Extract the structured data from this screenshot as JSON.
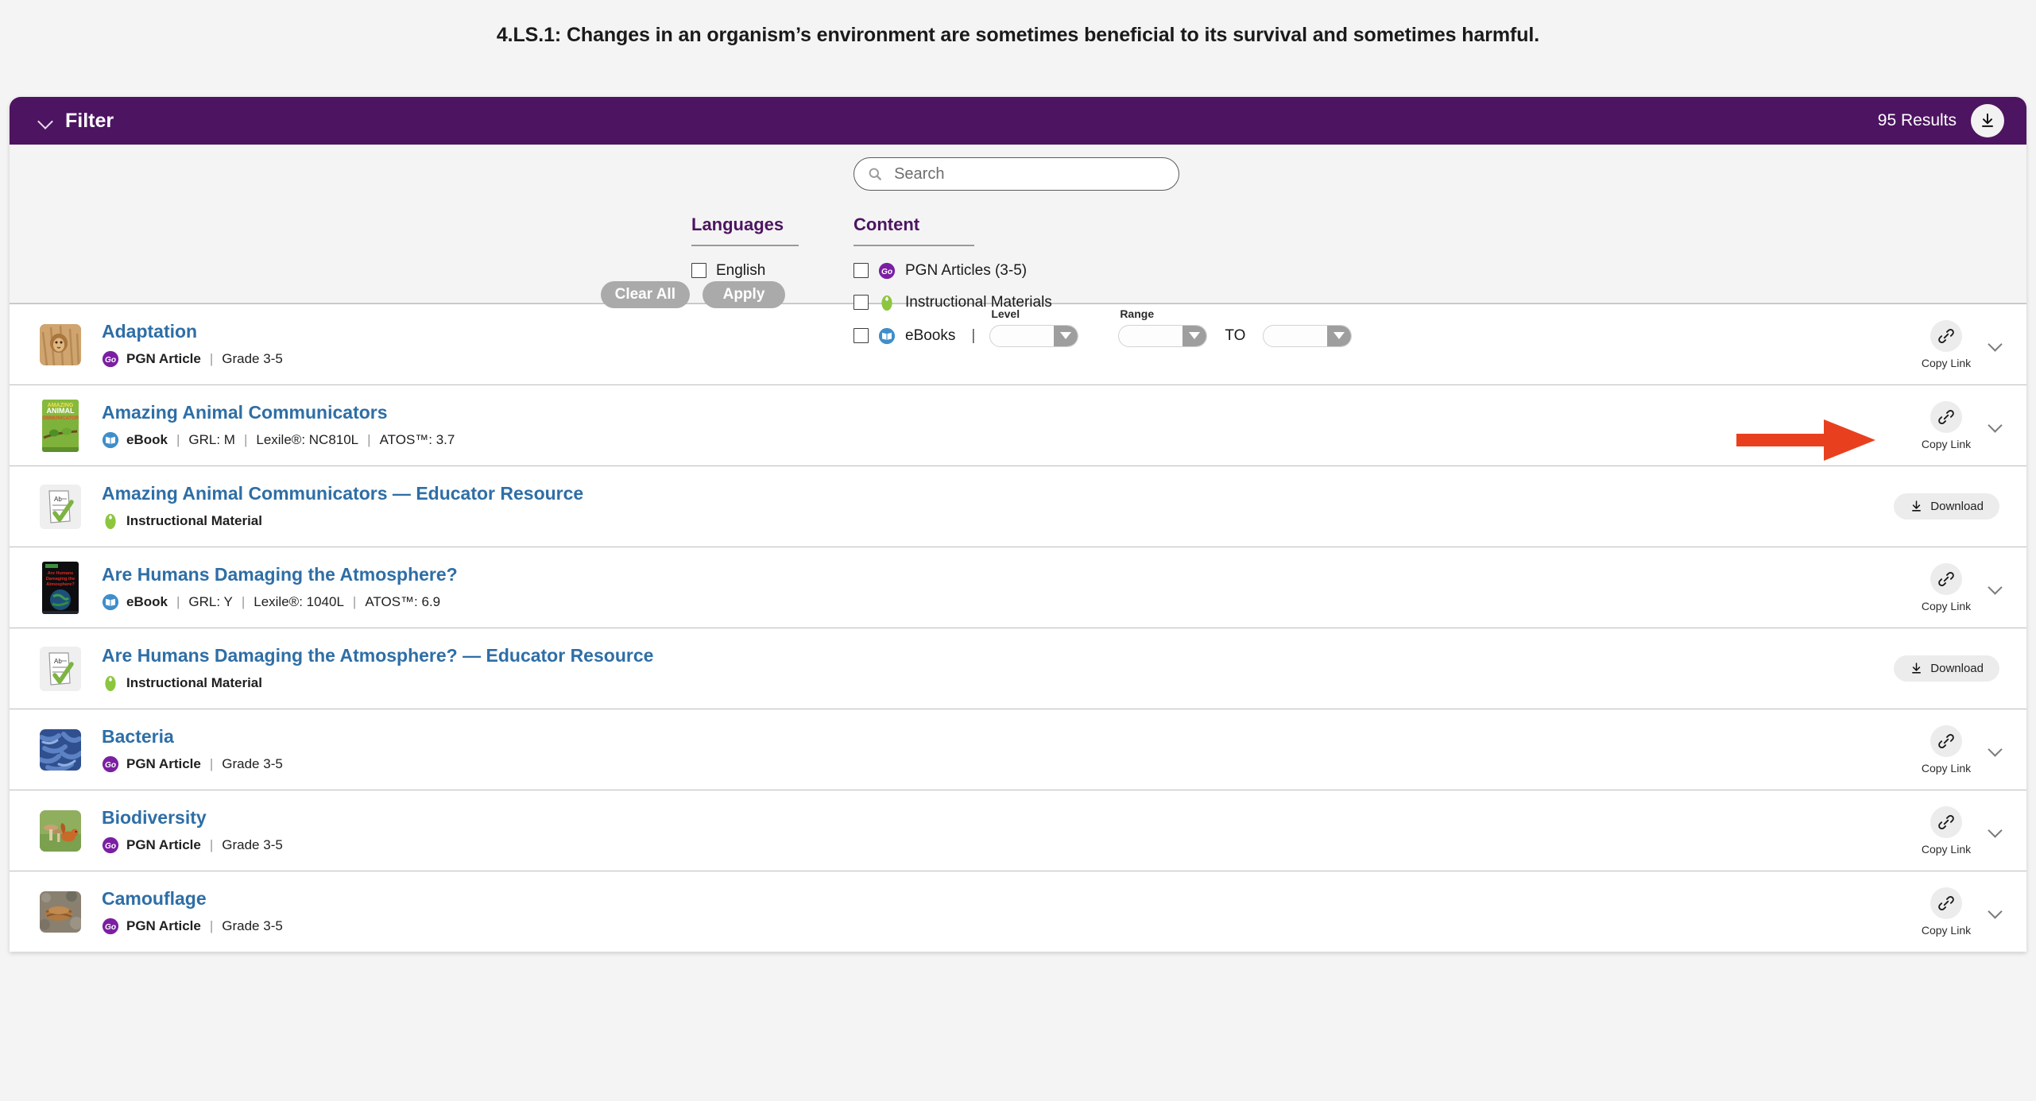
{
  "standard": {
    "title": "4.LS.1: Changes in an organism’s environment are sometimes beneficial to its survival and sometimes harmful."
  },
  "filter_bar": {
    "label": "Filter",
    "collapse_icon": "chevron-down-icon",
    "results_count": "95 Results",
    "download_icon": "download-icon"
  },
  "search": {
    "placeholder": "Search",
    "value": "",
    "icon": "search-icon"
  },
  "languages": {
    "heading": "Languages",
    "options": [
      {
        "label": "English",
        "checked": false
      }
    ]
  },
  "content": {
    "heading": "Content",
    "options": [
      {
        "label": "PGN Articles (3-5)",
        "icon": "pgn-go-badge-icon",
        "checked": false
      },
      {
        "label": "Instructional Materials",
        "icon": "instructional-material-badge-icon",
        "checked": false
      },
      {
        "label": "eBooks",
        "icon": "ebook-badge-icon",
        "checked": false
      }
    ],
    "level": {
      "caption": "Level",
      "value": ""
    },
    "range": {
      "caption": "Range",
      "from_value": "",
      "to_label": "TO",
      "to_value": ""
    }
  },
  "actions": {
    "clear_all": "Clear All",
    "apply": "Apply"
  },
  "results": [
    {
      "title": "Adaptation",
      "type": "PGN Article",
      "type_icon": "pgn-go-badge-icon",
      "extra": "Grade 3-5",
      "thumb": "lion-photo",
      "action": "copy-link",
      "action_label": "Copy Link"
    },
    {
      "title": "Amazing Animal Communicators",
      "type": "eBook",
      "type_icon": "ebook-badge-icon",
      "extra": "GRL: M  |  Lexile®: NC810L  |  ATOS™: 3.7",
      "extra_parts": [
        "GRL: M",
        "Lexile®: NC810L",
        "ATOS™: 3.7"
      ],
      "thumb": "book-cover-frogs",
      "action": "copy-link",
      "action_label": "Copy Link"
    },
    {
      "title": "Amazing Animal Communicators — Educator Resource",
      "type": "Instructional Material",
      "type_icon": "instructional-material-badge-icon",
      "extra": "",
      "extra_parts": [],
      "thumb": "worksheet-icon",
      "action": "download",
      "action_label": "Download"
    },
    {
      "title": "Are Humans Damaging the Atmosphere?",
      "type": "eBook",
      "type_icon": "ebook-badge-icon",
      "extra": "GRL: Y  |  Lexile®: 1040L  |  ATOS™: 6.9",
      "extra_parts": [
        "GRL: Y",
        "Lexile®: 1040L",
        "ATOS™: 6.9"
      ],
      "thumb": "book-cover-atmosphere",
      "action": "copy-link",
      "action_label": "Copy Link"
    },
    {
      "title": "Are Humans Damaging the Atmosphere? — Educator Resource",
      "type": "Instructional Material",
      "type_icon": "instructional-material-badge-icon",
      "extra": "",
      "extra_parts": [],
      "thumb": "worksheet-icon",
      "action": "download",
      "action_label": "Download"
    },
    {
      "title": "Bacteria",
      "type": "PGN Article",
      "type_icon": "pgn-go-badge-icon",
      "extra": "Grade 3-5",
      "extra_parts": [
        "Grade 3-5"
      ],
      "thumb": "bacteria-photo",
      "action": "copy-link",
      "action_label": "Copy Link"
    },
    {
      "title": "Biodiversity",
      "type": "PGN Article",
      "type_icon": "pgn-go-badge-icon",
      "extra": "Grade 3-5",
      "extra_parts": [
        "Grade 3-5"
      ],
      "thumb": "squirrel-mushroom-photo",
      "action": "copy-link",
      "action_label": "Copy Link"
    },
    {
      "title": "Camouflage",
      "type": "PGN Article",
      "type_icon": "pgn-go-badge-icon",
      "extra": "Grade 3-5",
      "extra_parts": [
        "Grade 3-5"
      ],
      "thumb": "camouflage-photo",
      "action": "copy-link",
      "action_label": "Copy Link"
    }
  ],
  "annotation": {
    "arrow_color": "#e8401f",
    "points_to": "copy-link-button-row-1"
  },
  "colors": {
    "header_purple": "#4d1461",
    "title_blue": "#2e6ea6",
    "page_bg": "#f4f4f4",
    "badge_purple": "#7b1fa2",
    "badge_green": "#8cc63f",
    "badge_blue": "#3f8ecb"
  }
}
